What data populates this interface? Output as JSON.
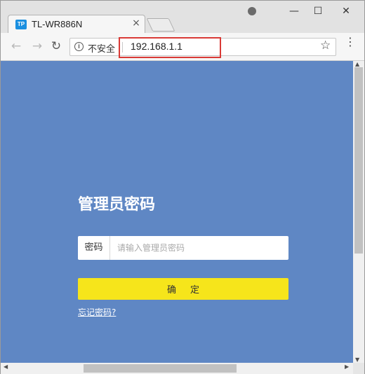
{
  "browser": {
    "tab": {
      "favicon_text": "TP",
      "title": "TL-WR886N",
      "close": "×"
    },
    "window_controls": {
      "minimize": "—",
      "maximize": "☐",
      "close": "✕"
    },
    "toolbar": {
      "back": "←",
      "forward": "→",
      "reload": "↻",
      "security_label": "不安全",
      "url": "192.168.1.1",
      "star": "☆",
      "menu": "⋮"
    }
  },
  "login": {
    "title": "管理员密码",
    "password_label": "密码",
    "password_placeholder": "请输入管理员密码",
    "password_value": "",
    "confirm_label": "确定",
    "forgot_label": "忘记密码?"
  },
  "colors": {
    "page_background": "#5f87c4",
    "button": "#f6e51b",
    "highlight": "#d93a36"
  }
}
